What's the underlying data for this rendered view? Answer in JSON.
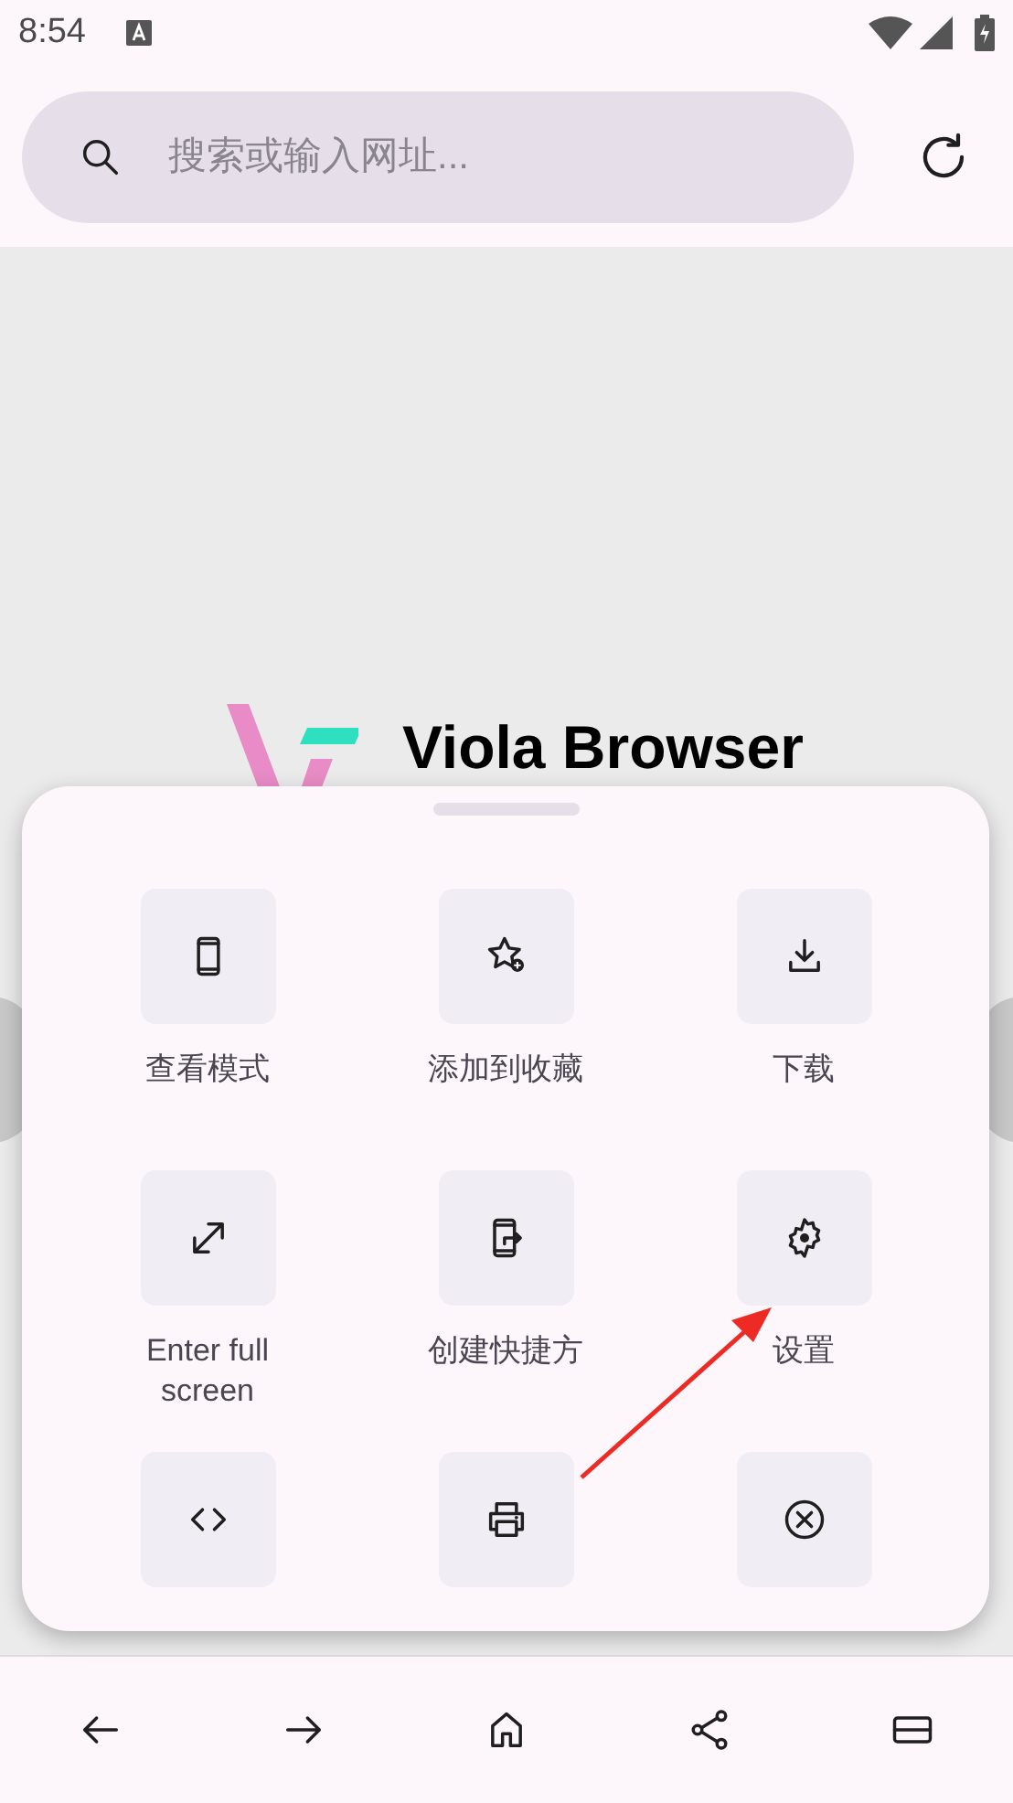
{
  "status_bar": {
    "time": "8:54"
  },
  "search": {
    "placeholder": "搜索或输入网址..."
  },
  "page": {
    "title": "Viola Browser"
  },
  "menu": {
    "items": [
      {
        "kind": "phone",
        "label": "查看模式"
      },
      {
        "kind": "star-add",
        "label": "添加到收藏"
      },
      {
        "kind": "download",
        "label": "下载"
      },
      {
        "kind": "expand",
        "label": "Enter full screen"
      },
      {
        "kind": "shortcut",
        "label": "创建快捷方"
      },
      {
        "kind": "gear",
        "label": "设置"
      },
      {
        "kind": "code"
      },
      {
        "kind": "printer"
      },
      {
        "kind": "close"
      }
    ]
  },
  "bottom_nav": {
    "items": [
      {
        "kind": "back"
      },
      {
        "kind": "forward"
      },
      {
        "kind": "home"
      },
      {
        "kind": "share"
      },
      {
        "kind": "tabs"
      }
    ]
  }
}
